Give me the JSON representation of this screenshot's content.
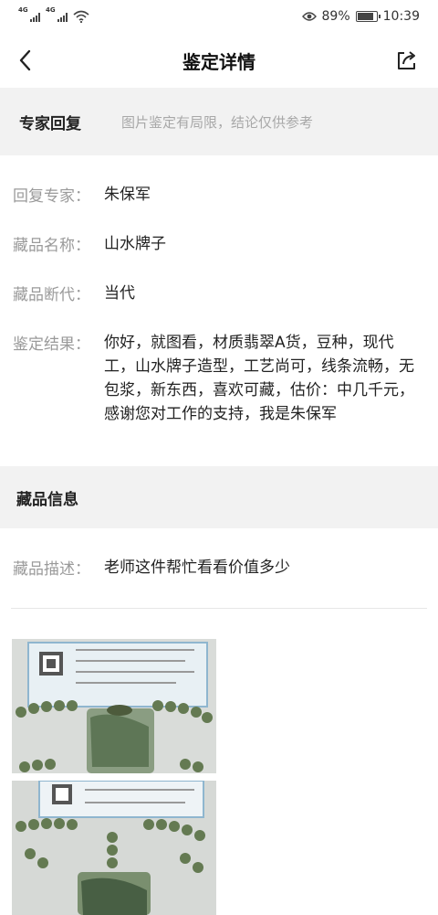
{
  "status": {
    "signal1": "4G",
    "signal2": "4G",
    "battery_pct": "89%",
    "battery_level": 0.89,
    "time": "10:39"
  },
  "nav": {
    "title": "鉴定详情",
    "back_icon": "chevron-left-icon",
    "share_icon": "share-icon"
  },
  "expert": {
    "heading": "专家回复",
    "disclaimer": "图片鉴定有局限，结论仅供参考",
    "fields": [
      {
        "label": "回复专家：",
        "value": "朱保军"
      },
      {
        "label": "藏品名称：",
        "value": "山水牌子"
      },
      {
        "label": "藏品断代：",
        "value": "当代"
      },
      {
        "label": "鉴定结果：",
        "value": "你好，就图看，材质翡翠A货，豆种，现代工，山水牌子造型，工艺尚可，线条流畅，无包浆，新东西，喜欢可藏，估价：中几千元，感谢您对工作的支持，我是朱保军"
      }
    ]
  },
  "item": {
    "heading": "藏品信息",
    "desc_label": "藏品描述：",
    "desc_value": "老师这件帮忙看看价值多少"
  },
  "photos": [
    {
      "name": "photo-pendant-in-hand"
    },
    {
      "name": "photo-pendant-with-certificate"
    },
    {
      "name": "photo-pendant-back-with-certificate"
    },
    {
      "name": "photo-pendant-beads-certificate"
    }
  ],
  "colors": {
    "banner_bg": "#f2f2f2",
    "label": "#9a9a9a",
    "text": "#222222",
    "jade_green": "#5f7d4e"
  }
}
